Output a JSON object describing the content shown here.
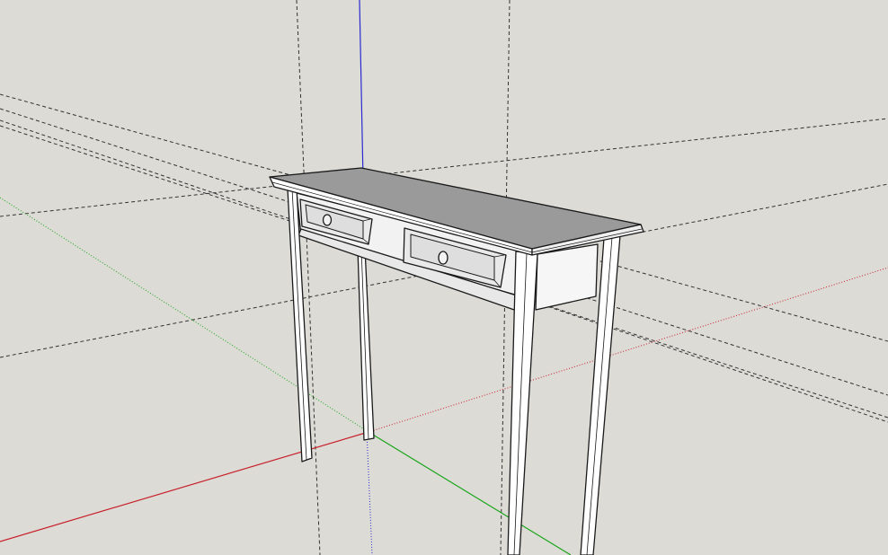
{
  "scene": {
    "background_color": "#dcdbd6",
    "axis_colors": {
      "red_axis": "#c8202a",
      "green_axis": "#1aa51a",
      "blue_axis": "#2a2ad0"
    },
    "guide_line_color": "#333333",
    "model_colors": {
      "top_surface": "#9a9a9a",
      "side_faces": "#ffffff",
      "shaded_faces": "#e4e4e4",
      "outline": "#1a1a1a"
    },
    "model": "console-table-with-two-drawers"
  }
}
